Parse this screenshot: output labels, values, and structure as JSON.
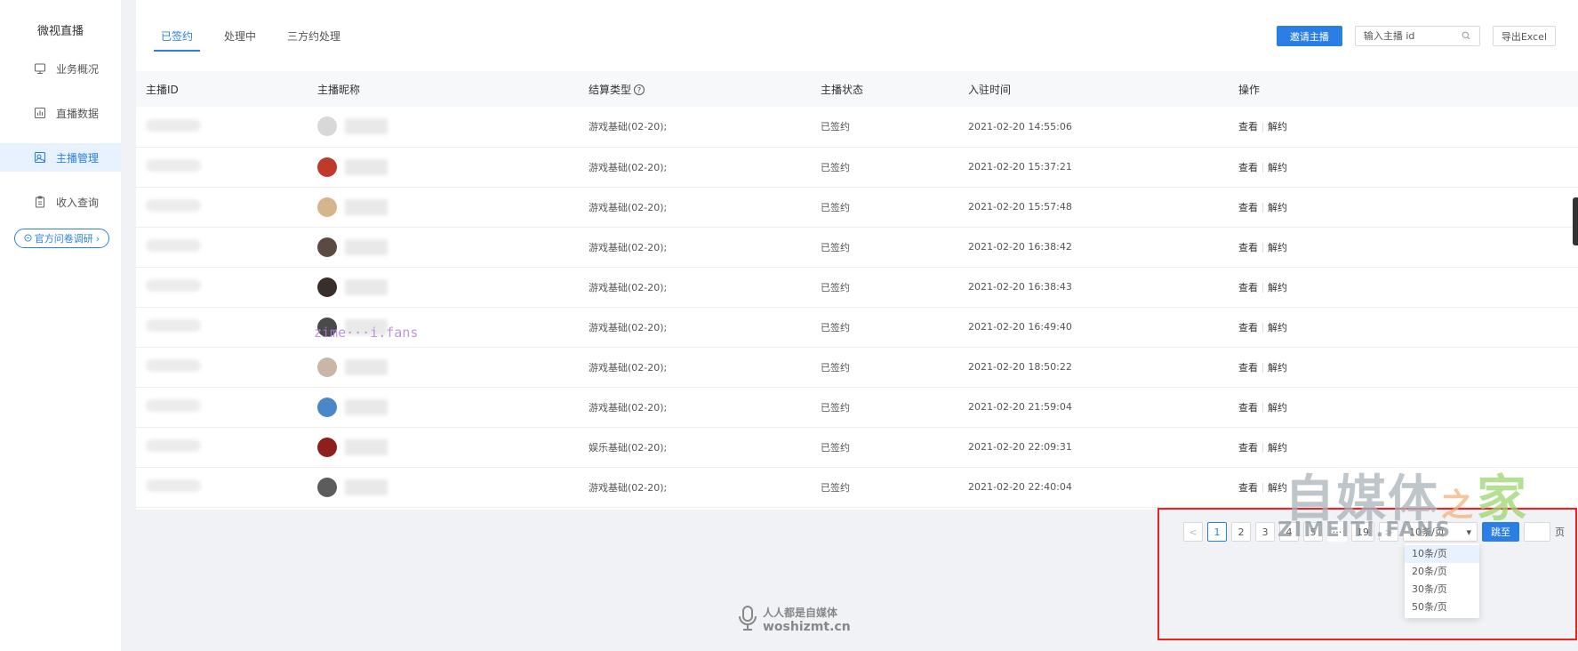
{
  "sidebar": {
    "title": "微视直播",
    "items": [
      {
        "label": "业务概况",
        "icon": "monitor-icon",
        "active": false
      },
      {
        "label": "直播数据",
        "icon": "chart-icon",
        "active": false
      },
      {
        "label": "主播管理",
        "icon": "user-manage-icon",
        "active": true
      },
      {
        "label": "收入查询",
        "icon": "clipboard-icon",
        "active": false
      }
    ],
    "survey": "官方问卷调研"
  },
  "tabs": [
    "已签约",
    "处理中",
    "三方约处理"
  ],
  "toolbar": {
    "invite": "邀请主播",
    "search_placeholder": "输入主播 id",
    "export": "导出Excel"
  },
  "table": {
    "columns": [
      "主播ID",
      "主播昵称",
      "结算类型",
      "主播状态",
      "入驻时间",
      "操作"
    ],
    "rows": [
      {
        "type": "游戏基础(02-20);",
        "status": "已签约",
        "time": "2021-02-20 14:55:06",
        "avatar_color": "#d8d8d8"
      },
      {
        "type": "游戏基础(02-20);",
        "status": "已签约",
        "time": "2021-02-20 15:37:21",
        "avatar_color": "#c0392b"
      },
      {
        "type": "游戏基础(02-20);",
        "status": "已签约",
        "time": "2021-02-20 15:57:48",
        "avatar_color": "#d6b48c"
      },
      {
        "type": "游戏基础(02-20);",
        "status": "已签约",
        "time": "2021-02-20 16:38:42",
        "avatar_color": "#5a4a42"
      },
      {
        "type": "游戏基础(02-20);",
        "status": "已签约",
        "time": "2021-02-20 16:38:43",
        "avatar_color": "#3b2e2a"
      },
      {
        "type": "游戏基础(02-20);",
        "status": "已签约",
        "time": "2021-02-20 16:49:40",
        "avatar_color": "#4a4a4a"
      },
      {
        "type": "游戏基础(02-20);",
        "status": "已签约",
        "time": "2021-02-20 18:50:22",
        "avatar_color": "#c9b6a6"
      },
      {
        "type": "游戏基础(02-20);",
        "status": "已签约",
        "time": "2021-02-20 21:59:04",
        "avatar_color": "#4a86c8"
      },
      {
        "type": "娱乐基础(02-20);",
        "status": "已签约",
        "time": "2021-02-20 22:09:31",
        "avatar_color": "#8e1f1f"
      },
      {
        "type": "游戏基础(02-20);",
        "status": "已签约",
        "time": "2021-02-20 22:40:04",
        "avatar_color": "#5c5c5c"
      }
    ],
    "action_view": "查看",
    "action_unsign": "解约"
  },
  "pagination": {
    "prev": "<",
    "pages": [
      "1",
      "2",
      "3",
      "4",
      "5"
    ],
    "ellipsis": "···",
    "last": "19",
    "next": ">",
    "current": "1",
    "jump": "跳至",
    "page_unit": "页",
    "page_size_options": [
      "10条/页",
      "20条/页",
      "30条/页",
      "50条/页"
    ],
    "selected_size": "10条/页"
  },
  "watermarks": {
    "purple": "zime···i.fans",
    "brand_a": "自媒体",
    "brand_b": "之",
    "brand_c": "家",
    "brand_sub": "ZIMEITI.FANS",
    "bottom_1": "人人都是自媒体",
    "bottom_2": "woshizmt.cn"
  },
  "colors": {
    "accent": "#2b7fe4",
    "highlight": "#e22222"
  }
}
